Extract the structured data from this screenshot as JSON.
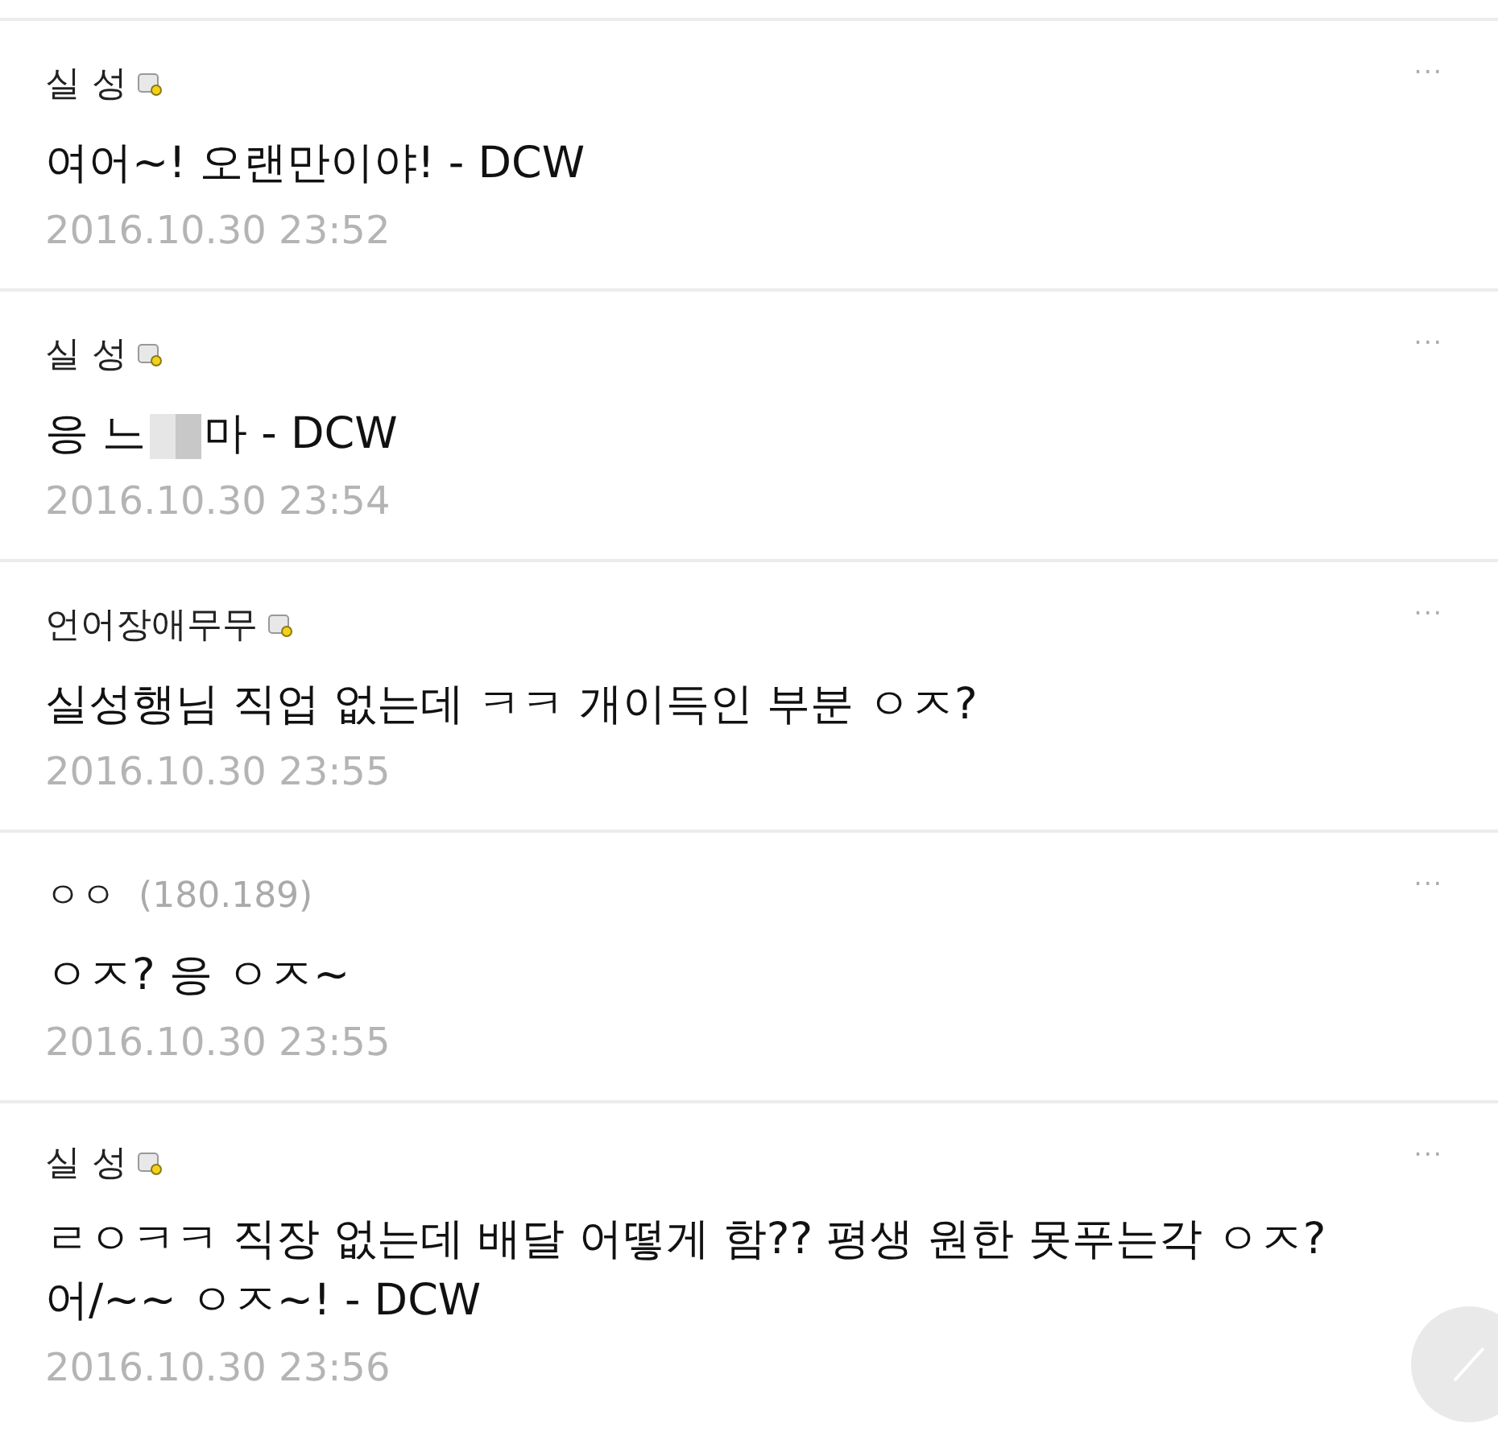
{
  "comments": [
    {
      "author": "실 성",
      "badge": true,
      "body": [
        {
          "kind": "text",
          "text": "여어~! 오랜만이야! - DCW"
        }
      ],
      "date": "2016.10.30 23:52",
      "menu": "···"
    },
    {
      "author": "실 성",
      "badge": true,
      "body": [
        {
          "kind": "text",
          "text": "응 느"
        },
        {
          "kind": "redacted"
        },
        {
          "kind": "text",
          "text": "마 - DCW"
        }
      ],
      "date": "2016.10.30 23:54",
      "menu": "···"
    },
    {
      "author": "언어장애무무",
      "badge": true,
      "body": [
        {
          "kind": "text",
          "text": "실성행님 직업 없는데 ㅋㅋ 개이득인 부분 ㅇㅈ?"
        }
      ],
      "date": "2016.10.30 23:55",
      "menu": "···"
    },
    {
      "author": "ㅇㅇ",
      "ip": "(180.189)",
      "badge": false,
      "body": [
        {
          "kind": "text",
          "text": "ㅇㅈ? 응 ㅇㅈ~"
        }
      ],
      "date": "2016.10.30 23:55",
      "menu": "···"
    },
    {
      "author": "실 성",
      "badge": true,
      "body": [
        {
          "kind": "text",
          "text": "ㄹㅇㅋㅋ 직장 없는데 배달 어떻게 함??  평생 원한 못푸는각 ㅇㅈ? 어/~~ ㅇㅈ~! - DCW"
        }
      ],
      "date": "2016.10.30 23:56",
      "menu": "···"
    }
  ]
}
